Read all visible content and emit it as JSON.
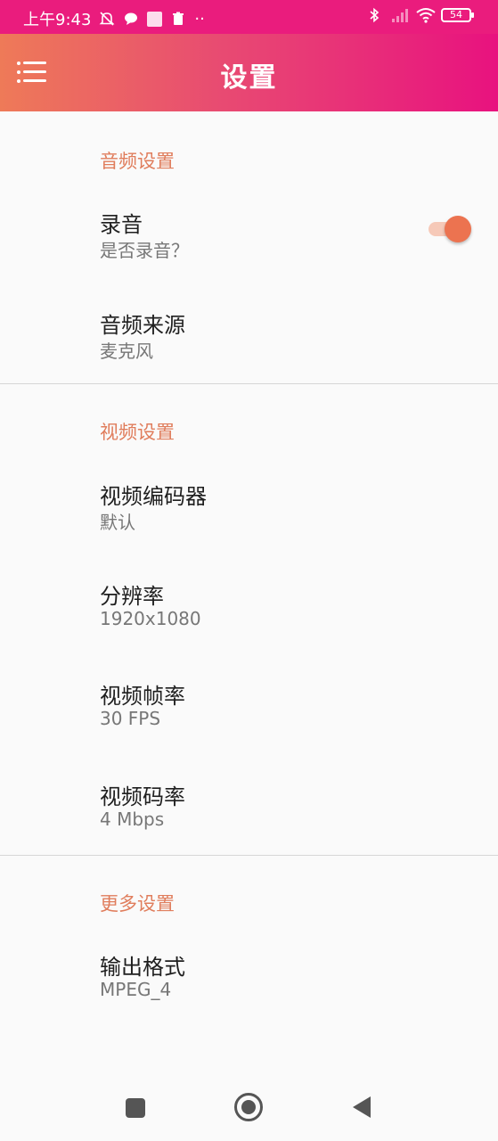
{
  "status_bar": {
    "time": "上午9:43",
    "battery": "54",
    "icons": [
      "mute-icon",
      "chat-bubble-icon",
      "app-square-icon",
      "trash-icon",
      "more-dots-icon",
      "bluetooth-icon",
      "signal-icon",
      "wifi-icon",
      "battery-icon"
    ],
    "more_dots": "··"
  },
  "toolbar": {
    "title": "设置",
    "menu_icon": "menu-list-icon"
  },
  "sections": [
    {
      "title": "音频设置",
      "items": [
        {
          "title": "录音",
          "summary": "是否录音？",
          "switch_on": true
        },
        {
          "title": "音频来源",
          "summary": "麦克风"
        }
      ]
    },
    {
      "title": "视频设置",
      "items": [
        {
          "title": "视频编码器",
          "summary": "默认"
        },
        {
          "title": "分辨率",
          "summary": "1920x1080"
        },
        {
          "title": "视频帧率",
          "summary": "30 FPS"
        },
        {
          "title": "视频码率",
          "summary": "4 Mbps"
        }
      ]
    },
    {
      "title": "更多设置",
      "items": [
        {
          "title": "输出格式",
          "summary": "MPEG_4"
        }
      ]
    }
  ],
  "colors": {
    "status_bar": "#ea1c7d",
    "toolbar_gradient_start": "#ee7a58",
    "toolbar_gradient_end": "#e8127f",
    "accent": "#e07d5c",
    "switch_thumb": "#ec7350"
  },
  "nav_bar": {
    "icons": [
      "recents-square-icon",
      "home-circle-icon",
      "back-triangle-icon"
    ]
  }
}
